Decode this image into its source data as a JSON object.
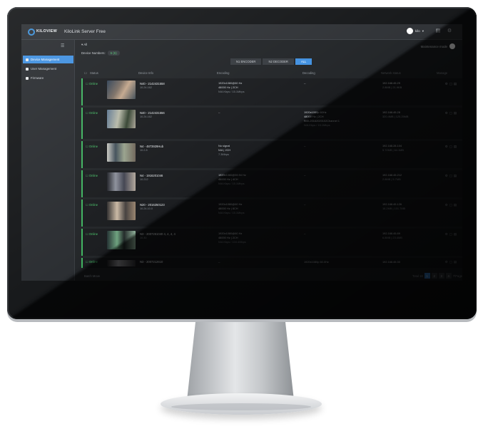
{
  "app": {
    "logo_text": "KILOVIEW",
    "title": "KiloLink Server Free"
  },
  "header": {
    "user_name": "kilo",
    "icons": [
      "user-icon",
      "document-icon",
      "settings-icon"
    ],
    "maintenance_label": "Maintenance mode"
  },
  "sidebar": {
    "items": [
      {
        "label": "Device Management",
        "icon": "device-icon",
        "active": true
      },
      {
        "label": "User Management",
        "icon": "user-icon",
        "active": false
      },
      {
        "label": "Firmware",
        "icon": "firmware-icon",
        "active": false
      }
    ]
  },
  "main": {
    "breadcrumb": "All",
    "device_numbers_label": "Device Numbers:",
    "device_numbers_value": "6 (6)",
    "filters": [
      {
        "label": "N1 ENCODER",
        "active": false
      },
      {
        "label": "N2 DECODER",
        "active": false
      },
      {
        "label": "ALL",
        "active": true
      }
    ],
    "columns": [
      "Status",
      "Device Info",
      "Encoding",
      "Decoding",
      "Network status",
      "Manage"
    ]
  },
  "rows": [
    {
      "status": "Online",
      "name": "N40 - 2142431558",
      "sub": "10.24.162",
      "encoding": [
        "1920x1080@60 Hz",
        "48000 Hz | 2CH",
        "N/A Kbps  / 15.1Mbps"
      ],
      "decoding": [
        "--"
      ],
      "ip": "192.168.45.29",
      "rates": "2.8MB | 21.9KB"
    },
    {
      "status": "Online",
      "name": "N40 - 2142431556",
      "sub": "10.24.162",
      "encoding": [
        "--"
      ],
      "decoding": [
        "1920x1080p 60Hz",
        "48000 Hz | 2CH",
        "N40-20162020102Channel 1",
        "N/A Kbps  / 15.1Mbps"
      ],
      "ip": "192.168.45.28",
      "rates": "320.4MB | 125.25MB"
    },
    {
      "status": "Online",
      "name": "N4 - 4873929Hub",
      "sub": "10.2.8",
      "encoding": [
        "No signal",
        "N/A | 2CH",
        "7.3Mbps"
      ],
      "decoding": [
        "--"
      ],
      "ip": "192.168.28.104",
      "rates": "5.72MB | 64.1MB"
    },
    {
      "status": "Online",
      "name": "N4 - 1916201046",
      "sub": "10.212",
      "encoding": [
        "1920x1080@59.94 Hz",
        "48000 Hz | 4CH",
        "N/A Kbps  / 15.1Mbps"
      ],
      "decoding": [
        "--"
      ],
      "ip": "192.168.45.212",
      "rates": "2.8MB | 5.7MB"
    },
    {
      "status": "Online",
      "name": "N20 - 2016250123",
      "sub": "10.24.10.0",
      "encoding": [
        "1920x1080@60 Hz",
        "48000 Hz | 8CH",
        "N/A Kbps  / 15.1Mbps"
      ],
      "decoding": [
        "--"
      ],
      "ip": "192.168.45.126",
      "rates": "16.2MB | 101.7MB"
    },
    {
      "status": "Online",
      "name": "N3 - 2007261040 4, 4, 4, 4",
      "sub": "10.30",
      "encoding": [
        "1920x1080@60 Hz",
        "48000 Hz | 2CH",
        "N/A Kbps  / 104.4Mbps"
      ],
      "decoding": [
        "--"
      ],
      "ip": "192.168.45.89",
      "rates": "6.8MB | 23.4MB"
    },
    {
      "status": "Online",
      "name": "N3 - 2007212610",
      "sub": "",
      "encoding": [
        "--"
      ],
      "decoding": [
        "1920x1080p 60.0Hz"
      ],
      "ip": "192.168.45.30",
      "rates": ""
    }
  ],
  "footer": {
    "batch_label": "Batch Move",
    "total_label": "Total 18",
    "pages": [
      "1",
      "2",
      "3",
      "4"
    ],
    "current_page": "1",
    "page_size": "7/Page"
  }
}
